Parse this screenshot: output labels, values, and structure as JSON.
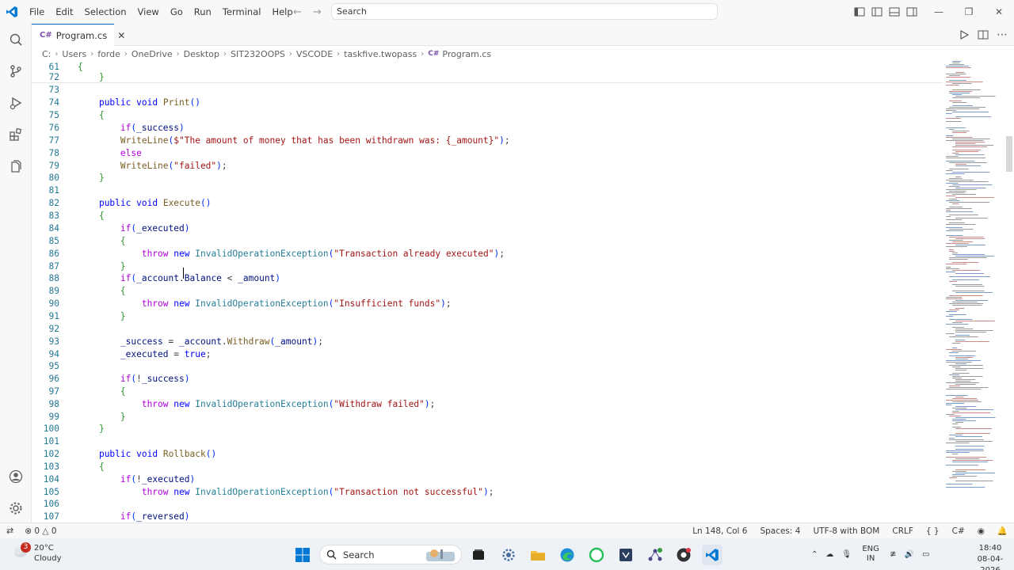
{
  "menu": [
    "File",
    "Edit",
    "Selection",
    "View",
    "Go",
    "Run",
    "Terminal",
    "Help"
  ],
  "search": {
    "placeholder": "Search"
  },
  "tab": {
    "label": "Program.cs",
    "icon": "csharp-icon"
  },
  "breadcrumb": [
    "C:",
    "Users",
    "forde",
    "OneDrive",
    "Desktop",
    "SIT232OOPS",
    "VSCODE",
    "taskfive.twopass",
    "Program.cs"
  ],
  "editor": {
    "lines": [
      {
        "n": "61",
        "code": "{"
      },
      {
        "n": "72",
        "code": "    }"
      },
      {
        "n": "73",
        "code": ""
      },
      {
        "n": "74",
        "code": "    public void Print()"
      },
      {
        "n": "75",
        "code": "    {"
      },
      {
        "n": "76",
        "code": "        if(_success)"
      },
      {
        "n": "77",
        "code": "        WriteLine($\"The amount of money that has been withdrawn was: {_amount}\");"
      },
      {
        "n": "78",
        "code": "        else"
      },
      {
        "n": "79",
        "code": "        WriteLine(\"failed\");"
      },
      {
        "n": "80",
        "code": "    }"
      },
      {
        "n": "81",
        "code": ""
      },
      {
        "n": "82",
        "code": "    public void Execute()"
      },
      {
        "n": "83",
        "code": "    {"
      },
      {
        "n": "84",
        "code": "        if(_executed)"
      },
      {
        "n": "85",
        "code": "        {"
      },
      {
        "n": "86",
        "code": "            throw new InvalidOperationException(\"Transaction already executed\");"
      },
      {
        "n": "87",
        "code": "        }"
      },
      {
        "n": "88",
        "code": "        if(_account.Balance < _amount)"
      },
      {
        "n": "89",
        "code": "        {"
      },
      {
        "n": "90",
        "code": "            throw new InvalidOperationException(\"Insufficient funds\");"
      },
      {
        "n": "91",
        "code": "        }"
      },
      {
        "n": "92",
        "code": ""
      },
      {
        "n": "93",
        "code": "        _success = _account.Withdraw(_amount);"
      },
      {
        "n": "94",
        "code": "        _executed = true;"
      },
      {
        "n": "95",
        "code": ""
      },
      {
        "n": "96",
        "code": "        if(!_success)"
      },
      {
        "n": "97",
        "code": "        {"
      },
      {
        "n": "98",
        "code": "            throw new InvalidOperationException(\"Withdraw failed\");"
      },
      {
        "n": "99",
        "code": "        }"
      },
      {
        "n": "100",
        "code": "    }"
      },
      {
        "n": "101",
        "code": ""
      },
      {
        "n": "102",
        "code": "    public void Rollback()"
      },
      {
        "n": "103",
        "code": "    {"
      },
      {
        "n": "104",
        "code": "        if(!_executed)"
      },
      {
        "n": "105",
        "code": "            throw new InvalidOperationException(\"Transaction not successful\");"
      },
      {
        "n": "106",
        "code": ""
      },
      {
        "n": "107",
        "code": "        if(_reversed)"
      }
    ]
  },
  "status": {
    "errors": "0",
    "warnings": "0",
    "position": "Ln 148, Col 6",
    "spaces": "Spaces: 4",
    "encoding": "UTF-8 with BOM",
    "eol": "CRLF",
    "language": "C#"
  },
  "taskbar": {
    "weather_temp": "20°C",
    "weather_desc": "Cloudy",
    "weather_badge": "3",
    "search_label": "Search",
    "lang": "ENG",
    "region": "IN",
    "time": "18:40",
    "date": "08-04-2026"
  },
  "colors": {
    "accent": "#005fb8",
    "keyword": "#0000ff",
    "function": "#795e26",
    "type": "#267f99",
    "string": "#a31515",
    "line_number": "#237893"
  }
}
